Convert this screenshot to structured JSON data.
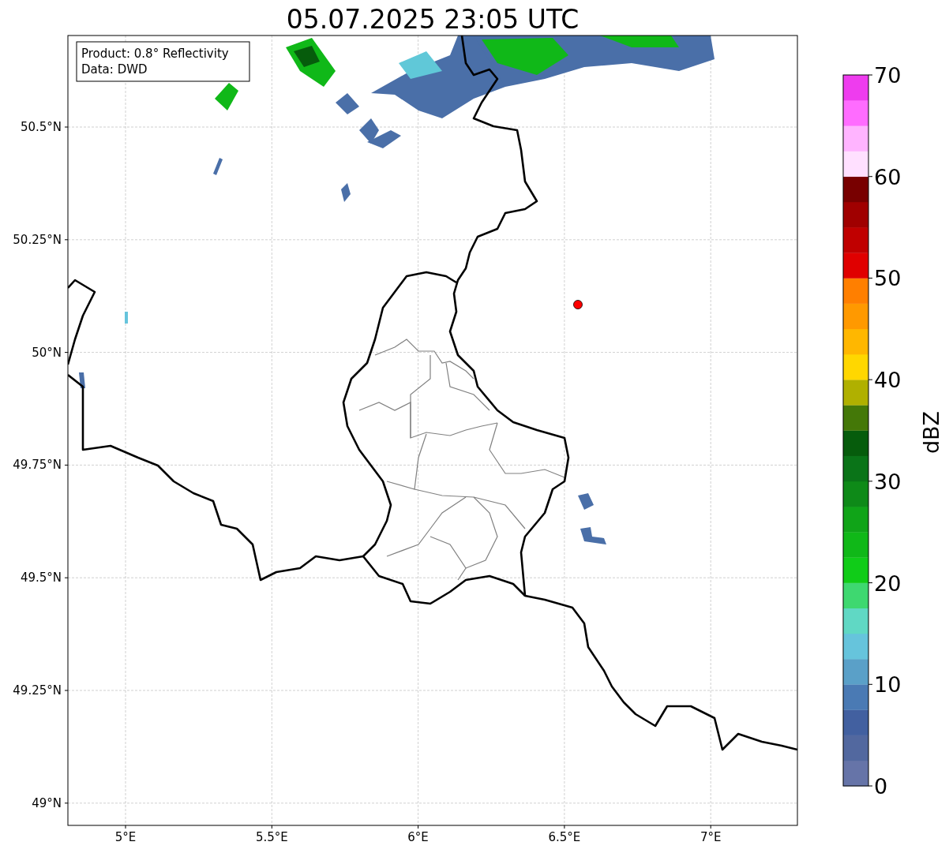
{
  "title": "05.07.2025 23:05 UTC",
  "legend": [
    "Product: 0.8° Reflectivity",
    "Data: DWD"
  ],
  "map": {
    "lat_ticks": [
      "50.5°N",
      "50.25°N",
      "50°N",
      "49.75°N",
      "49.5°N",
      "49.25°N",
      "49°N"
    ],
    "lon_ticks": [
      "5°E",
      "5.5°E",
      "6°E",
      "6.5°E",
      "7°E"
    ]
  },
  "colorbar": {
    "label": "dBZ",
    "ticks": [
      "70",
      "60",
      "50",
      "40",
      "30",
      "20",
      "10",
      "0"
    ],
    "bands": [
      {
        "color": "#6674a8"
      },
      {
        "color": "#52689f"
      },
      {
        "color": "#4260a0"
      },
      {
        "color": "#4a7ab4"
      },
      {
        "color": "#5aa0c8"
      },
      {
        "color": "#66c4dc"
      },
      {
        "color": "#60d8c4"
      },
      {
        "color": "#3ed870"
      },
      {
        "color": "#10cc18"
      },
      {
        "color": "#10b818"
      },
      {
        "color": "#10a418"
      },
      {
        "color": "#0e8a18"
      },
      {
        "color": "#0a7418"
      },
      {
        "color": "#065c0c"
      },
      {
        "color": "#447808"
      },
      {
        "color": "#b0b000"
      },
      {
        "color": "#ffd700"
      },
      {
        "color": "#ffb700"
      },
      {
        "color": "#ff9900"
      },
      {
        "color": "#ff7f00"
      },
      {
        "color": "#e00000"
      },
      {
        "color": "#c00000"
      },
      {
        "color": "#a00000"
      },
      {
        "color": "#780000"
      },
      {
        "color": "#ffe0ff"
      },
      {
        "color": "#ffb4ff"
      },
      {
        "color": "#ff6cff"
      },
      {
        "color": "#ee3cee"
      }
    ]
  }
}
